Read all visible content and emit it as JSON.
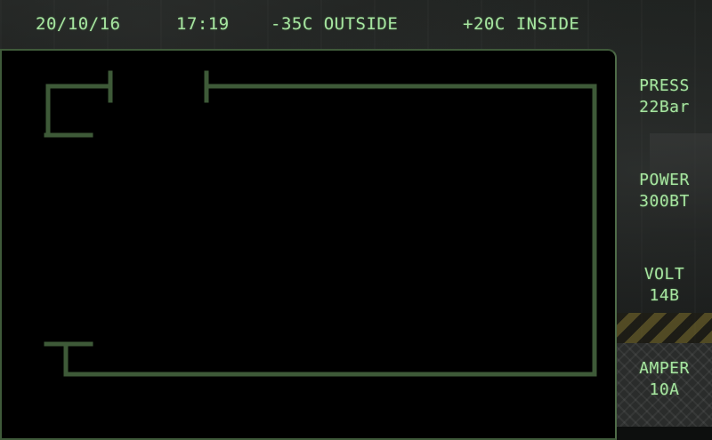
{
  "status_bar": {
    "date": "20/10/16",
    "time": "17:19",
    "outside_temp": "-35C OUTSIDE",
    "inside_temp": "+20C INSIDE"
  },
  "readouts": {
    "pressure": {
      "label": "PRESS",
      "value": "22Bar"
    },
    "power": {
      "label": "POWER",
      "value": "300BT"
    },
    "voltage": {
      "label": "VOLT",
      "value": "14B"
    },
    "current": {
      "label": "AMPER",
      "value": "10A"
    }
  },
  "colors": {
    "text": "#a6e5a0",
    "frame": "#3f5a3a",
    "screen": "#000000"
  }
}
